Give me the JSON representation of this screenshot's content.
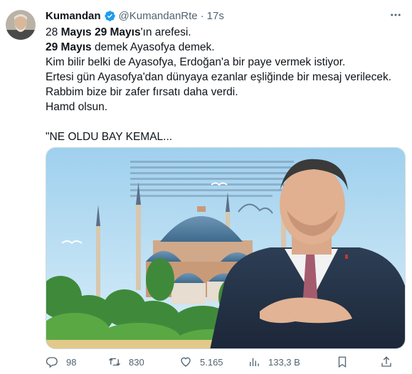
{
  "author": {
    "display_name": "Kumandan",
    "handle": "@KumandanRte",
    "separator": "·",
    "time": "17s"
  },
  "tweet": {
    "line1_a": "28 ",
    "line1_b": "Mayıs 29 Mayıs",
    "line1_c": "'ın arefesi.",
    "line2_a": "29 Mayıs",
    "line2_b": " demek Ayasofya demek.",
    "line3": "Kim bilir belki de Ayasofya, Erdoğan'a bir paye vermek istiyor.",
    "line4": "Ertesi gün Ayasofya'dan dünyaya ezanlar eşliğinde bir mesaj verilecek.",
    "line5": "Rabbim bize bir zafer fırsatı daha verdi.",
    "line6": "Hamd olsun.",
    "line7": "\"NE OLDU BAY KEMAL..."
  },
  "actions": {
    "replies": "98",
    "retweets": "830",
    "likes": "5.165",
    "views": "133,3 B"
  },
  "icons": {
    "verified": "verified-badge-icon",
    "more": "more-options-icon",
    "reply": "reply-icon",
    "retweet": "retweet-icon",
    "like": "heart-icon",
    "views": "views-chart-icon",
    "bookmark": "bookmark-icon",
    "share": "share-icon"
  },
  "colors": {
    "verified_blue": "#1d9bf0",
    "text": "#0f1419",
    "muted": "#536471"
  }
}
